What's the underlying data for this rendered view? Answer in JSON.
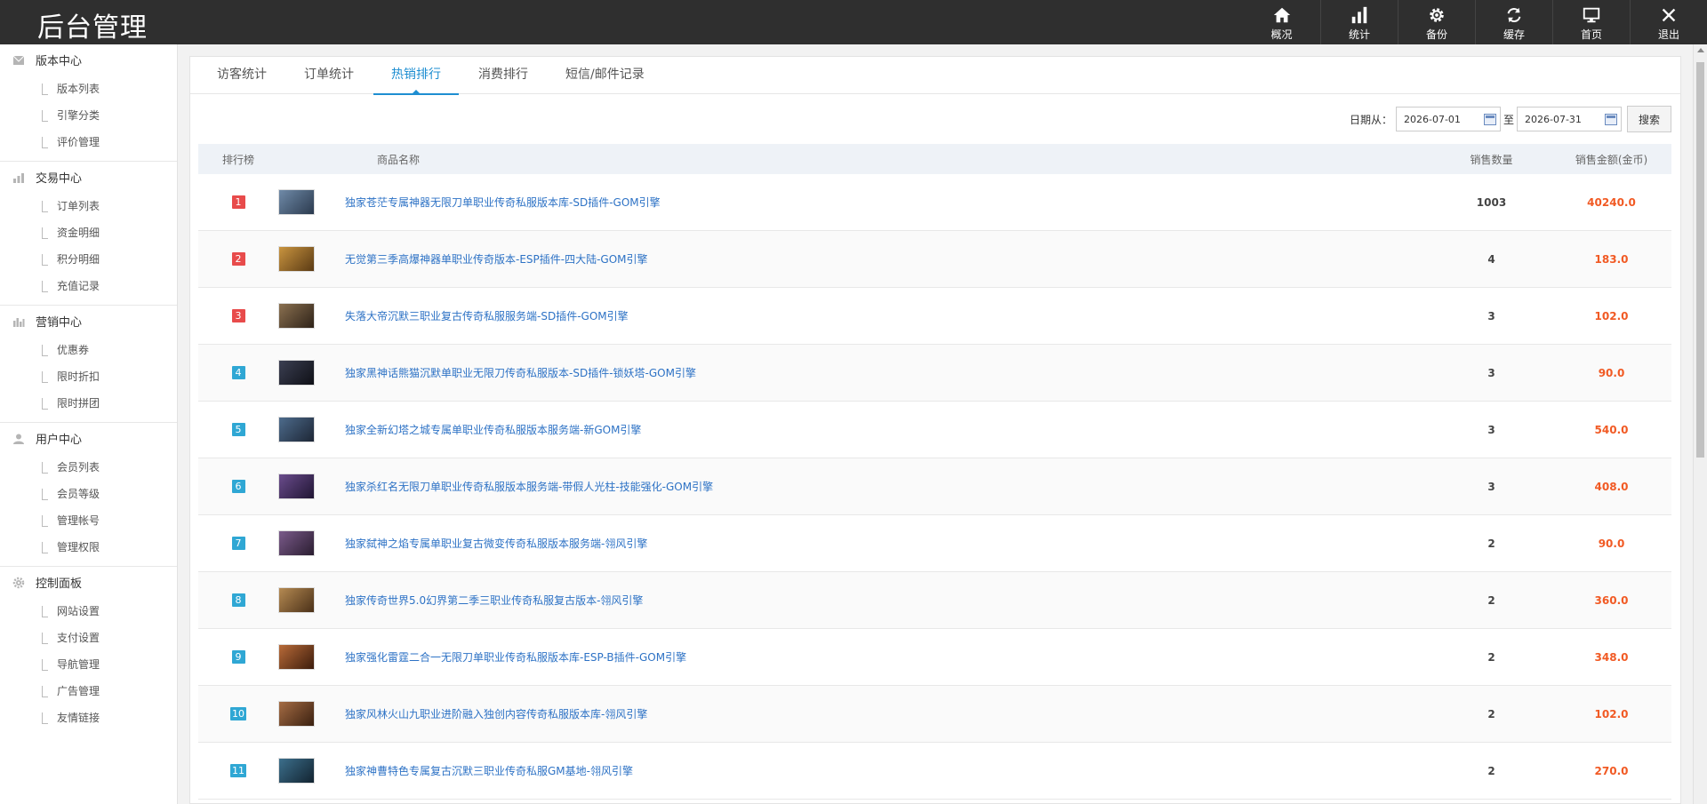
{
  "app": {
    "title": "后台管理"
  },
  "topnav": [
    {
      "label": "概况",
      "icon": "home-icon"
    },
    {
      "label": "统计",
      "icon": "bar-chart-icon"
    },
    {
      "label": "备份",
      "icon": "gear-icon"
    },
    {
      "label": "缓存",
      "icon": "refresh-icon"
    },
    {
      "label": "首页",
      "icon": "monitor-icon"
    },
    {
      "label": "退出",
      "icon": "close-icon"
    }
  ],
  "sidebar": [
    {
      "title": "版本中心",
      "icon": "mail-icon",
      "items": [
        "版本列表",
        "引擎分类",
        "评价管理"
      ]
    },
    {
      "title": "交易中心",
      "icon": "bar-chart-icon",
      "items": [
        "订单列表",
        "资金明细",
        "积分明细",
        "充值记录"
      ]
    },
    {
      "title": "营销中心",
      "icon": "chart-icon",
      "items": [
        "优惠券",
        "限时折扣",
        "限时拼团"
      ]
    },
    {
      "title": "用户中心",
      "icon": "user-icon",
      "items": [
        "会员列表",
        "会员等级",
        "管理帐号",
        "管理权限"
      ]
    },
    {
      "title": "控制面板",
      "icon": "gear-icon",
      "items": [
        "网站设置",
        "支付设置",
        "导航管理",
        "广告管理",
        "友情链接"
      ]
    }
  ],
  "tabs": [
    {
      "label": "访客统计",
      "active": false
    },
    {
      "label": "订单统计",
      "active": false
    },
    {
      "label": "热销排行",
      "active": true
    },
    {
      "label": "消费排行",
      "active": false
    },
    {
      "label": "短信/邮件记录",
      "active": false
    }
  ],
  "filter": {
    "date_label": "日期从：",
    "start_date": "2026-07-01",
    "to_label": "至",
    "end_date": "2026-07-31",
    "search_label": "搜索"
  },
  "table": {
    "headers": {
      "rank": "排行榜",
      "name": "商品名称",
      "qty": "销售数量",
      "amount": "销售金额(金币)"
    },
    "rows": [
      {
        "rank": "1",
        "name": "独家苍茫专属神器无限刀单职业传奇私服版本库-SD插件-GOM引擎",
        "qty": "1003",
        "amount": "40240.0"
      },
      {
        "rank": "2",
        "name": "无觉第三季高爆神器单职业传奇版本-ESP插件-四大陆-GOM引擎",
        "qty": "4",
        "amount": "183.0"
      },
      {
        "rank": "3",
        "name": "失落大帝沉默三职业复古传奇私服服务端-SD插件-GOM引擎",
        "qty": "3",
        "amount": "102.0"
      },
      {
        "rank": "4",
        "name": "独家黑神话熊猫沉默单职业无限刀传奇私服版本-SD插件-锁妖塔-GOM引擎",
        "qty": "3",
        "amount": "90.0"
      },
      {
        "rank": "5",
        "name": "独家全新幻塔之城专属单职业传奇私服版本服务端-新GOM引擎",
        "qty": "3",
        "amount": "540.0"
      },
      {
        "rank": "6",
        "name": "独家杀红名无限刀单职业传奇私服版本服务端-带假人光柱-技能强化-GOM引擎",
        "qty": "3",
        "amount": "408.0"
      },
      {
        "rank": "7",
        "name": "独家弑神之焰专属单职业复古微变传奇私服版本服务端-翎风引擎",
        "qty": "2",
        "amount": "90.0"
      },
      {
        "rank": "8",
        "name": "独家传奇世界5.0幻界第二季三职业传奇私服复古版本-翎风引擎",
        "qty": "2",
        "amount": "360.0"
      },
      {
        "rank": "9",
        "name": "独家强化雷霆二合一无限刀单职业传奇私服版本库-ESP-B插件-GOM引擎",
        "qty": "2",
        "amount": "348.0"
      },
      {
        "rank": "10",
        "name": "独家风林火山九职业进阶融入独创内容传奇私服版本库-翎风引擎",
        "qty": "2",
        "amount": "102.0"
      },
      {
        "rank": "11",
        "name": "独家神曹特色专属复古沉默三职业传奇私服GM基地-翎风引擎",
        "qty": "2",
        "amount": "270.0"
      }
    ]
  },
  "colors": {
    "accent": "#1e8ed1",
    "amount": "#f15a24",
    "link": "#2d72c5",
    "top_rank": "#e84b4b",
    "rank": "#2fa7d4"
  }
}
